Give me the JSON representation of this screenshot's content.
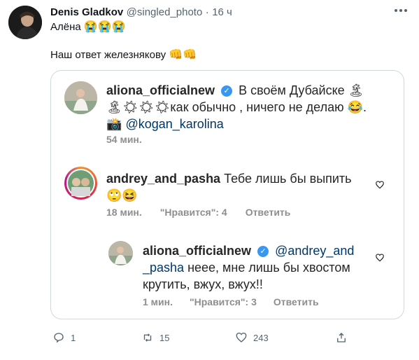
{
  "tweet": {
    "author_name": "Denis Gladkov",
    "author_handle": "@singled_photo",
    "separator": "·",
    "time": "16 ч",
    "text_line1": "Алёна",
    "text_line1_emoji": "😭😭😭",
    "text_line2": "Наш ответ железнякову",
    "text_line2_emoji": "👊👊"
  },
  "instagram": {
    "post": {
      "username": "aliona_officialnew",
      "text_part1": "В своём Дубайске 🏝",
      "text_part2": "🏝☀☀☀как обычно , ничего не делаю 😂.",
      "text_part3_icon": "📸",
      "mention": "@kogan_karolina",
      "time": "54 мин."
    },
    "comment1": {
      "username": "andrey_and_pasha",
      "text": "Тебе лишь бы выпить",
      "emoji": "🙄😆",
      "time": "18 мин.",
      "likes": "\"Нравится\": 4",
      "reply": "Ответить"
    },
    "comment2": {
      "username": "aliona_officialnew",
      "mention_part1": "@andrey_and",
      "mention_part2": "_pasha",
      "text_part1": " неее, мне лишь бы хвостом",
      "text_part2": "крутить, вжух, вжух!!",
      "time": "1 мин.",
      "likes": "\"Нравится\": 3",
      "reply": "Ответить"
    }
  },
  "actions": {
    "reply_count": "1",
    "retweet_count": "15",
    "like_count": "243"
  },
  "colors": {
    "twitter_blue": "#1d9bf0",
    "instagram_verified": "#3897f0",
    "text_gray": "#536471"
  }
}
